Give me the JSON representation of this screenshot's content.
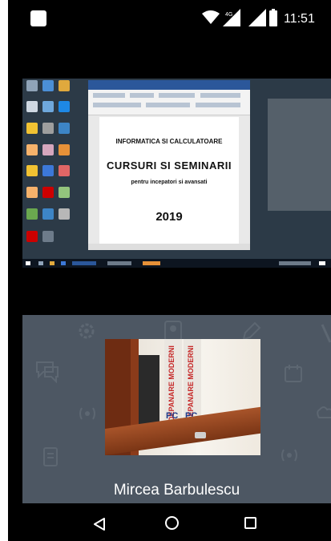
{
  "status_bar": {
    "time": "11:51",
    "network_label": "4G",
    "icons": [
      "app-notification-icon",
      "wifi-icon",
      "cellular-signal-icon",
      "cellular-signal-icon",
      "battery-icon"
    ]
  },
  "shared_screen": {
    "document": {
      "line1": "INFORMATICA SI CALCULATOARE",
      "line2": "CURSURI SI SEMINARII",
      "line3": "pentru incepatori si avansati",
      "line4": "2019"
    }
  },
  "video_tile": {
    "participant_name": "Mircea Barbulescu",
    "book_spine_text": "DEPANARE MODERNIZA",
    "book_logo": "PC",
    "background_icons": [
      "chat-icon",
      "gear-icon",
      "person-icon",
      "pencil-icon",
      "phone-icon",
      "calendar-icon",
      "podcast-icon",
      "document-icon",
      "cloud-icon"
    ]
  },
  "navigation_bar": {
    "buttons": [
      "back",
      "home",
      "recent-apps"
    ]
  },
  "colors": {
    "background": "#000000",
    "tile_background": "#4d5763",
    "word_blue": "#2b579a"
  }
}
